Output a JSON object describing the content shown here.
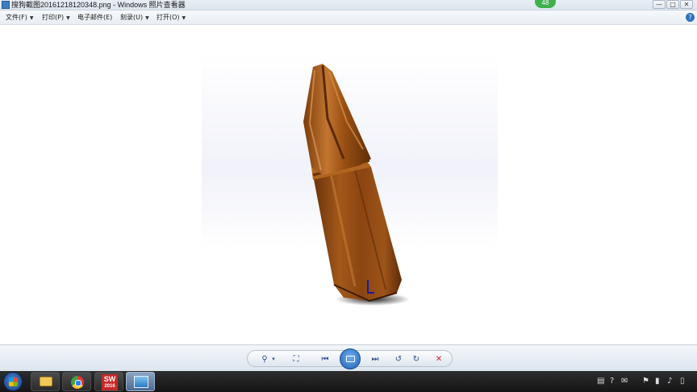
{
  "window": {
    "title": "搜狗截图20161218120348.png - Windows 照片查看器",
    "notification_count": "48",
    "controls": [
      "—",
      "□",
      "✕"
    ]
  },
  "menu": [
    {
      "label": "文件(F)"
    },
    {
      "label": "打印(P)"
    },
    {
      "label": "电子邮件(E)"
    },
    {
      "label": "刻录(U)"
    },
    {
      "label": "打开(O)"
    }
  ],
  "help_label": "?",
  "image": {
    "subject": "screwdriver-bit-3d-model",
    "colors": {
      "body": "#9a4f14",
      "highlight": "#c0722a",
      "shadow": "#5a2a08",
      "background": "#f1f2fa"
    }
  },
  "controls": {
    "zoom": "⚲",
    "zoom_arrow": "▾",
    "fit": "⛶",
    "previous": "⏮",
    "next": "⏭",
    "rotate_left": "↺",
    "rotate_right": "↻",
    "delete": "✕"
  },
  "taskbar": {
    "apps": [
      "file-explorer",
      "chrome",
      "solidworks-2016",
      "windows-photo-viewer"
    ],
    "solidworks_label": "SW",
    "solidworks_year": "2016",
    "tray": [
      "▤",
      "?",
      "✉",
      "⚑",
      "▮",
      "♪",
      "▯"
    ]
  }
}
